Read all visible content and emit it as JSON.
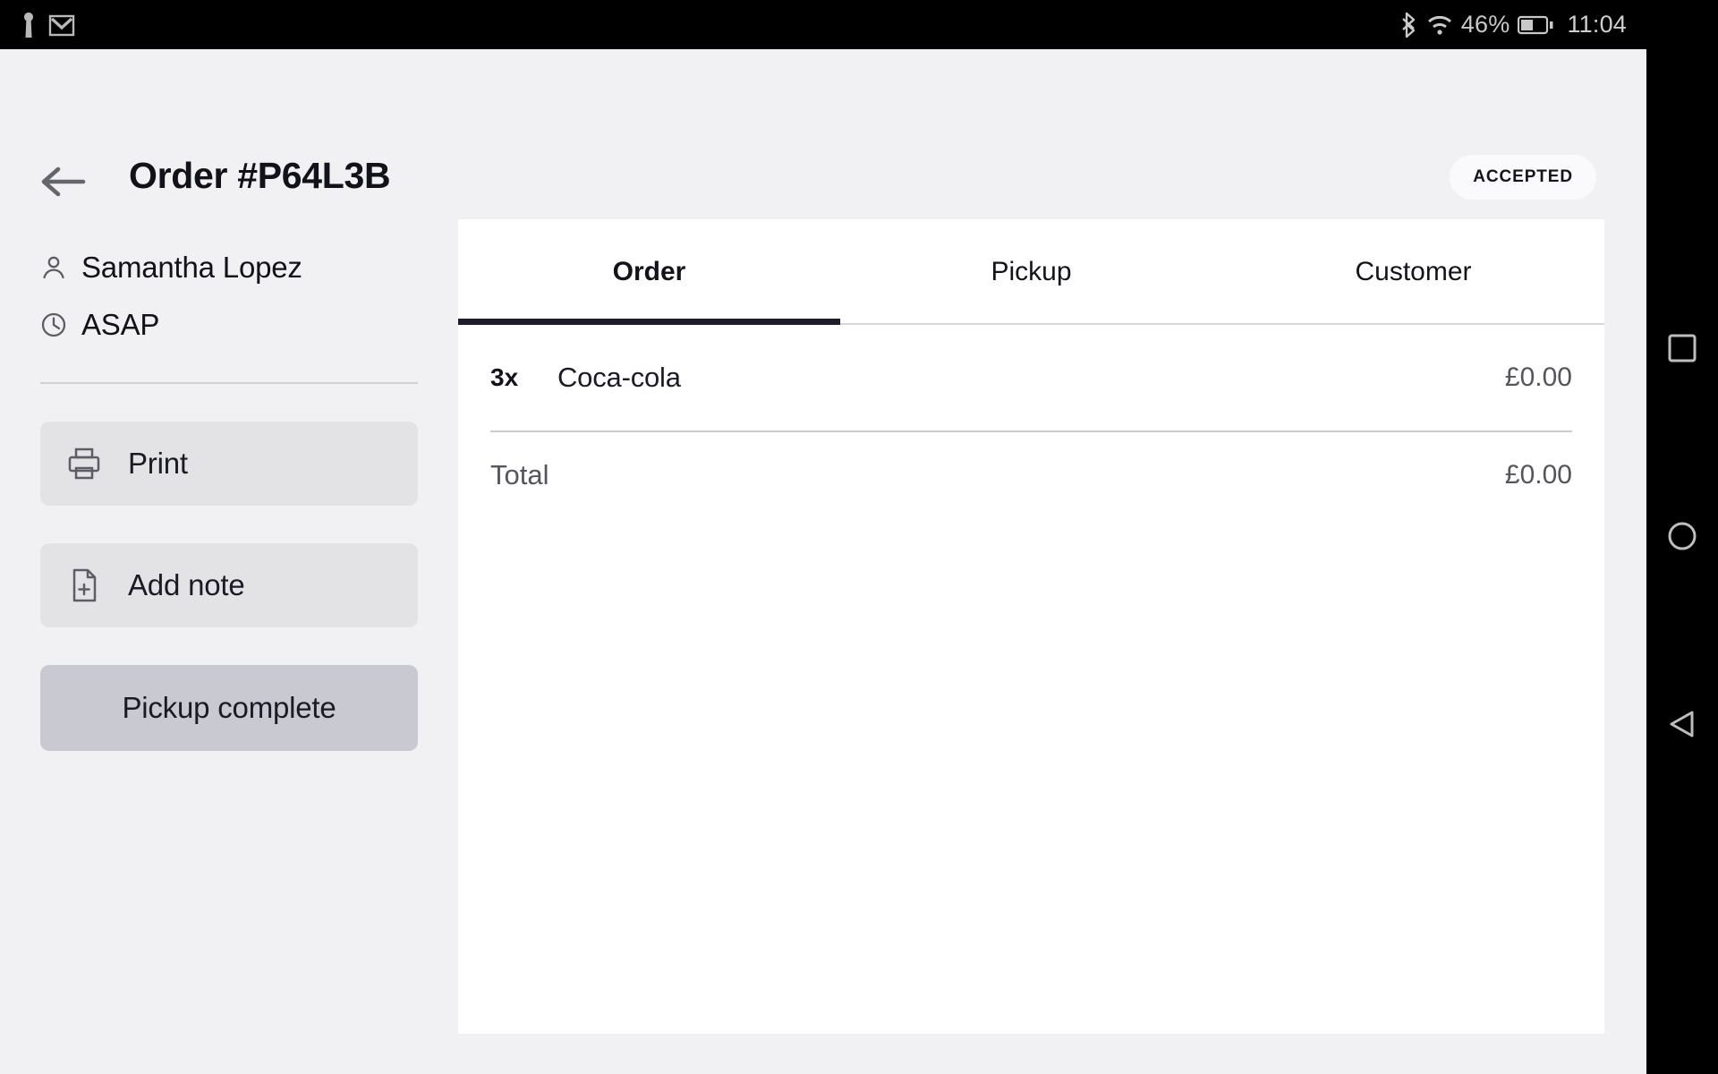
{
  "statusbar": {
    "left_icons": [
      "key-icon",
      "gmail-icon"
    ],
    "bluetooth_icon": "bluetooth-icon",
    "wifi_icon": "wifi-icon",
    "battery_percent": "46%",
    "battery_icon": "battery-icon",
    "time": "11:04"
  },
  "navbar": {
    "recents_label": "recents-square-icon",
    "home_label": "home-circle-icon",
    "back_label": "back-triangle-icon"
  },
  "header": {
    "back_icon": "arrow-left-icon",
    "title": "Order #P64L3B",
    "status": "ACCEPTED"
  },
  "sidebar": {
    "customer_icon": "person-icon",
    "customer_name": "Samantha Lopez",
    "time_icon": "clock-icon",
    "time_value": "ASAP",
    "buttons": [
      {
        "label": "Print",
        "icon": "printer-icon"
      },
      {
        "label": "Add note",
        "icon": "note-add-icon"
      }
    ],
    "primary_button": {
      "label": "Pickup complete"
    }
  },
  "main": {
    "tabs": [
      {
        "label": "Order",
        "active": true
      },
      {
        "label": "Pickup",
        "active": false
      },
      {
        "label": "Customer",
        "active": false
      }
    ],
    "items": [
      {
        "qty": "3x",
        "name": "Coca-cola",
        "price": "£0.00"
      }
    ],
    "total_label": "Total",
    "total_price": "£0.00"
  },
  "colors": {
    "background": "#f1f1f3",
    "card": "#ffffff",
    "accent_dark": "#1c1c2a",
    "button_gray": "#e3e3e6",
    "primary_button_gray": "#c9c9d1",
    "muted_text": "#55555e"
  }
}
